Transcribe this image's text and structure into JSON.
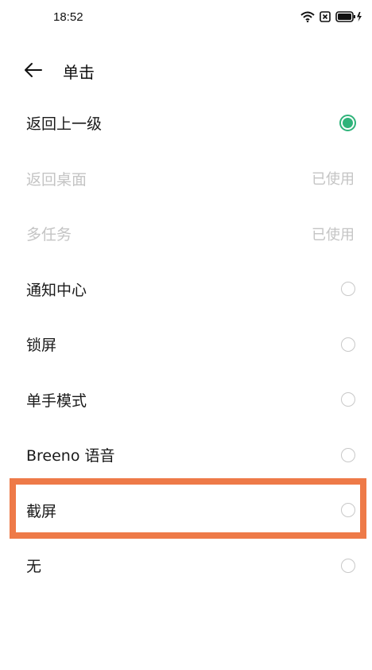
{
  "status": {
    "time": "18:52"
  },
  "header": {
    "title": "单击"
  },
  "items": [
    {
      "label": "返回上一级",
      "selected": true
    },
    {
      "label": "返回桌面",
      "disabled_note": "已使用"
    },
    {
      "label": "多任务",
      "disabled_note": "已使用"
    },
    {
      "label": "通知中心"
    },
    {
      "label": "锁屏"
    },
    {
      "label": "单手模式"
    },
    {
      "label": "Breeno 语音"
    },
    {
      "label": "截屏"
    },
    {
      "label": "无"
    }
  ],
  "colors": {
    "accent": "#2fb37a",
    "highlight": "#ee7a48"
  }
}
